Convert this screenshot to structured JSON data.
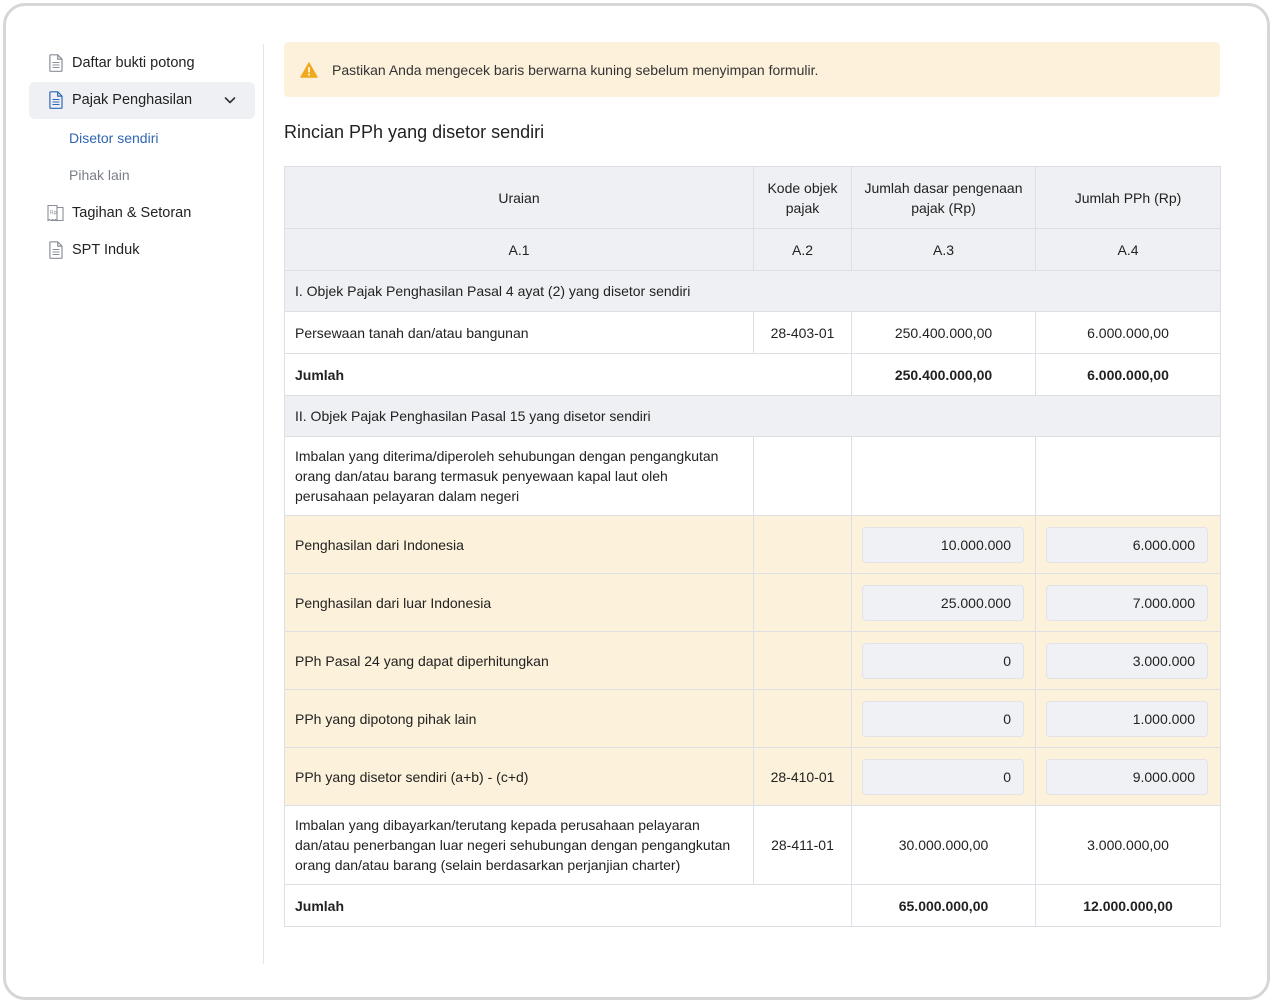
{
  "sidebar": {
    "items": [
      {
        "label": "Daftar bukti potong",
        "icon": "document-icon"
      },
      {
        "label": "Pajak Penghasilan",
        "icon": "document-icon",
        "expanded": true
      },
      {
        "label": "Tagihan & Setoran",
        "icon": "receipt-icon"
      },
      {
        "label": "SPT Induk",
        "icon": "document-icon"
      }
    ],
    "subitems": [
      "Disetor sendiri",
      "Pihak lain"
    ]
  },
  "alert": {
    "text": "Pastikan Anda mengecek baris berwarna kuning sebelum menyimpan formulir.",
    "icon": "warning-icon"
  },
  "section_title": "Rincian PPh yang disetor sendiri",
  "table": {
    "headers": [
      "Uraian",
      "Kode objek pajak",
      "Jumlah dasar pengenaan pajak (Rp)",
      "Jumlah PPh (Rp)"
    ],
    "codes": [
      "A.1",
      "A.2",
      "A.3",
      "A.4"
    ],
    "group1": {
      "title": "I. Objek Pajak Penghasilan Pasal 4 ayat (2) yang disetor sendiri",
      "row": {
        "uraian": "Persewaan tanah dan/atau bangunan",
        "kode": "28-403-01",
        "dpp": "250.400.000,00",
        "pph": "6.000.000,00"
      },
      "total": {
        "label": "Jumlah",
        "dpp": "250.400.000,00",
        "pph": "6.000.000,00"
      }
    },
    "group2": {
      "title": "II. Objek Pajak Penghasilan Pasal 15 yang disetor sendiri",
      "intro": "Imbalan yang diterima/diperoleh sehubungan dengan pengangkutan orang dan/atau barang termasuk penyewaan kapal laut oleh perusahaan pelayaran dalam negeri",
      "inputs": [
        {
          "uraian": "Penghasilan dari Indonesia",
          "kode": "",
          "dpp": "10.000.000",
          "pph": "6.000.000"
        },
        {
          "uraian": "Penghasilan dari luar Indonesia",
          "kode": "",
          "dpp": "25.000.000",
          "pph": "7.000.000"
        },
        {
          "uraian": "PPh Pasal 24 yang dapat diperhitungkan",
          "kode": "",
          "dpp": "0",
          "pph": "3.000.000"
        },
        {
          "uraian": "PPh yang dipotong pihak lain",
          "kode": "",
          "dpp": "0",
          "pph": "1.000.000"
        },
        {
          "uraian": "PPh yang disetor sendiri (a+b) - (c+d)",
          "kode": "28-410-01",
          "dpp": "0",
          "pph": "9.000.000"
        }
      ],
      "row": {
        "uraian": "Imbalan yang dibayarkan/terutang kepada perusahaan pelayaran dan/atau penerbangan luar negeri sehubungan dengan pengangkutan orang dan/atau barang (selain berdasarkan perjanjian charter)",
        "kode": "28-411-01",
        "dpp": "30.000.000,00",
        "pph": "3.000.000,00"
      },
      "total": {
        "label": "Jumlah",
        "dpp": "65.000.000,00",
        "pph": "12.000.000,00"
      }
    }
  },
  "colors": {
    "accent": "#2f66b3",
    "highlight": "#fcf1da",
    "alert_bg": "#fdf1dc",
    "warning": "#f0a81c"
  }
}
